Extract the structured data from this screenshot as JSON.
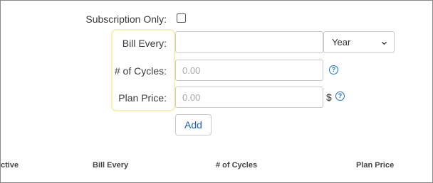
{
  "form": {
    "subscription_only_label": "Subscription Only:",
    "bill_every_label": "Bill Every:",
    "bill_every_value": "",
    "period_select_value": "Year",
    "cycles_label": "# of Cycles:",
    "cycles_placeholder": "0.00",
    "plan_price_label": "Plan Price:",
    "plan_price_placeholder": "0.00",
    "currency_symbol": "$",
    "help_glyph": "?",
    "add_button_label": "Add"
  },
  "table": {
    "headers": [
      "ctive",
      "Bill Every",
      "# of Cycles",
      "Plan Price"
    ]
  },
  "colors": {
    "accent": "#1a5fc4",
    "highlight_border": "#f7f0b8"
  },
  "icons": {
    "select_arrow": "chevron-down-icon",
    "help": "help-circle-icon",
    "checkbox": "checkbox-icon"
  }
}
